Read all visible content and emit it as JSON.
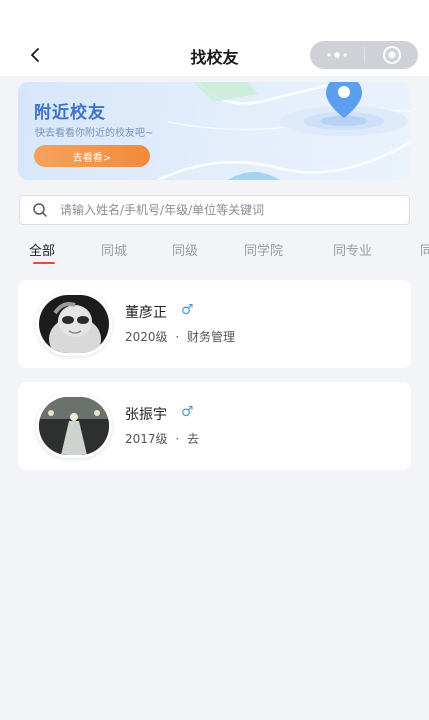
{
  "header": {
    "title": "找校友",
    "back_icon": "chevron-left-icon",
    "more_icon": "more-dots-icon",
    "close_icon": "target-close-icon"
  },
  "banner": {
    "title": "附近校友",
    "subtitle": "快去看看你附近的校友吧~",
    "button_label": "去看看>",
    "pin_icon": "location-pin-icon",
    "colors": {
      "title": "#3f72c9",
      "button": "#f28a3c",
      "pin": "#5b9ff0"
    }
  },
  "search": {
    "placeholder": "请输入姓名/手机号/年级/单位等关键词",
    "icon": "search-icon"
  },
  "tabs": [
    {
      "label": "全部",
      "active": true
    },
    {
      "label": "同城",
      "active": false
    },
    {
      "label": "同级",
      "active": false
    },
    {
      "label": "同学院",
      "active": false
    },
    {
      "label": "同专业",
      "active": false
    },
    {
      "label": "同",
      "active": false
    }
  ],
  "alumni": [
    {
      "name": "董彦正",
      "gender": "♂",
      "grade": "2020级",
      "separator": "·",
      "major": "财务管理"
    },
    {
      "name": "张振宇",
      "gender": "♂",
      "grade": "2017级",
      "separator": "·",
      "major": "去"
    }
  ],
  "colors": {
    "accent_red": "#e8493c",
    "gender_blue": "#4a9ae6"
  }
}
